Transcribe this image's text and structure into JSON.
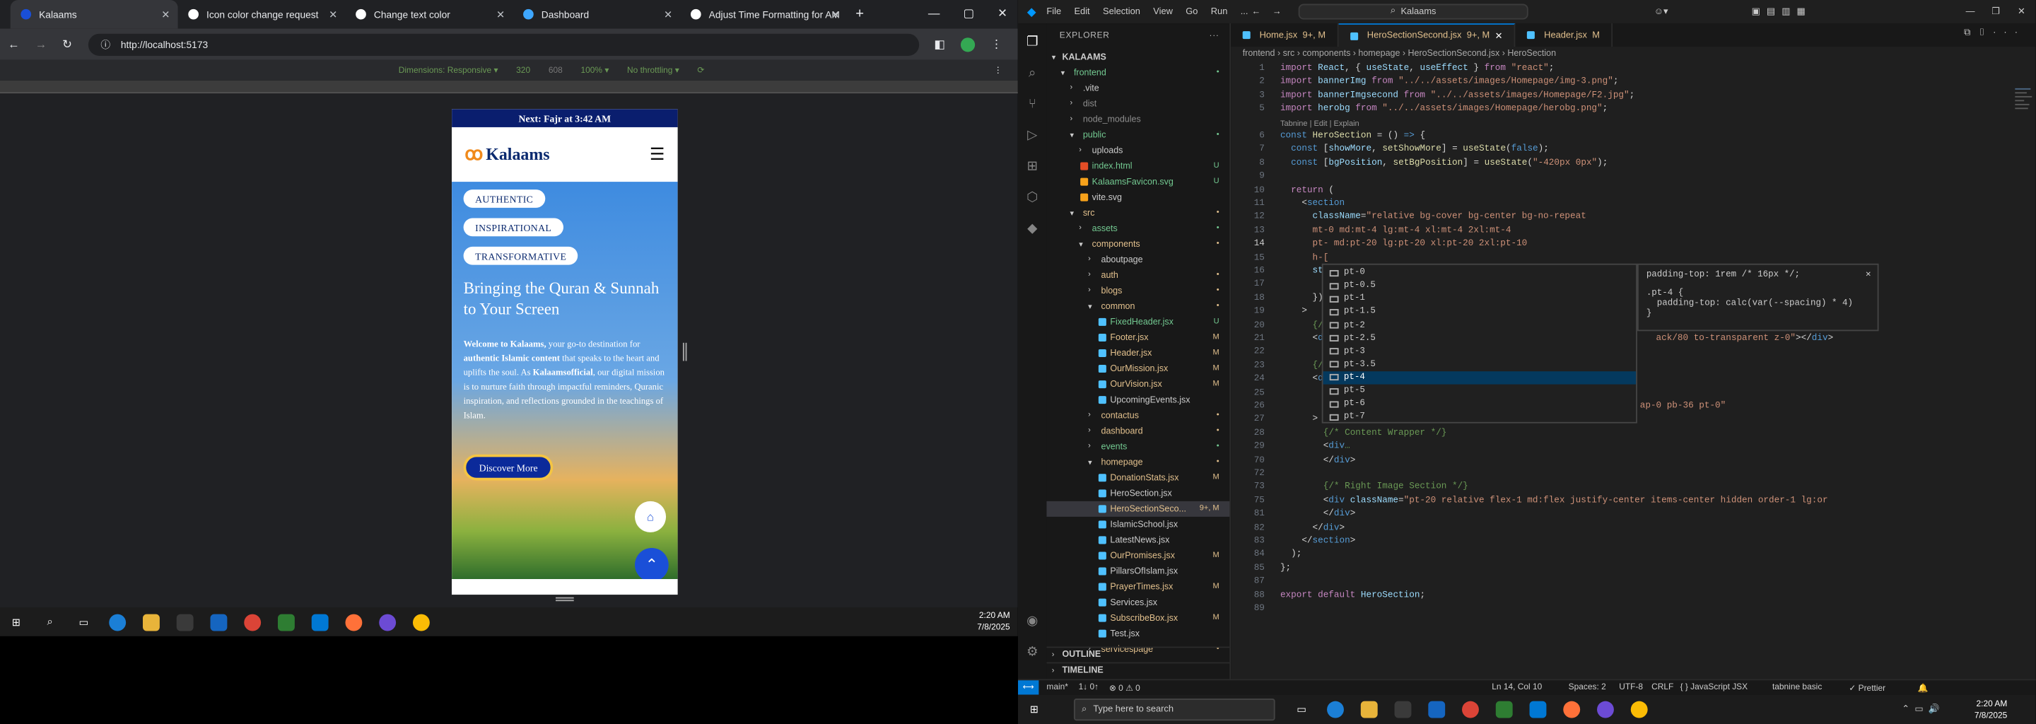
{
  "browser": {
    "tabs": [
      {
        "label": "Kalaams",
        "color": "#1a4fd8"
      },
      {
        "label": "Icon color change request",
        "color": "#ffffff"
      },
      {
        "label": "Change text color",
        "color": "#ffffff"
      },
      {
        "label": "Dashboard",
        "color": "#3ea7ff"
      },
      {
        "label": "Adjust Time Formatting for AM",
        "color": "#ffffff"
      }
    ],
    "url": "http://localhost:5173",
    "devtools": {
      "dimensions": "Dimensions: Responsive ▾",
      "width": "320",
      "height": "608",
      "zoom": "100% ▾",
      "throttle": "No throttling ▾"
    }
  },
  "site": {
    "prayer_banner": "Next: Fajr at 3:42 AM",
    "logo_text": "Kalaams",
    "pills": [
      "AUTHENTIC",
      "INSPIRATIONAL",
      "TRANSFORMATIVE"
    ],
    "hero_title": "Bringing the Quran & Sunnah to Your Screen",
    "hero_body_1": "Welcome to Kalaams,",
    "hero_body_2": " your go-to destination for ",
    "hero_body_3": "authentic Islamic content",
    "hero_body_4": " that speaks to the heart and uplifts the soul. As ",
    "hero_body_5": "Kalaamsofficial",
    "hero_body_6": ", our digital mission is to nurture faith through impactful reminders, Quranic inspiration, and reflections grounded in the teachings of Islam.",
    "cta": "Discover More"
  },
  "taskbar1": {
    "time": "2:20 AM",
    "date": "7/8/2025"
  },
  "vscode": {
    "menu": [
      "File",
      "Edit",
      "Selection",
      "View",
      "Go",
      "Run",
      "..."
    ],
    "search": "Kalaams",
    "explorer_title": "EXPLORER",
    "root": "KALAAMS",
    "tree": [
      {
        "name": "frontend",
        "depth": 1,
        "type": "folder-open",
        "badge": "•",
        "color": "#73c991"
      },
      {
        "name": ".vite",
        "depth": 2,
        "type": "folder",
        "badge": "",
        "color": "#cccccc"
      },
      {
        "name": "dist",
        "depth": 2,
        "type": "folder",
        "badge": "",
        "color": "#8c8c8c"
      },
      {
        "name": "node_modules",
        "depth": 2,
        "type": "folder",
        "badge": "",
        "color": "#8c8c8c"
      },
      {
        "name": "public",
        "depth": 2,
        "type": "folder-open",
        "badge": "•",
        "color": "#73c991"
      },
      {
        "name": "uploads",
        "depth": 3,
        "type": "folder",
        "badge": "",
        "color": "#cccccc"
      },
      {
        "name": "index.html",
        "depth": 3,
        "type": "html",
        "badge": "U",
        "color": "#73c991"
      },
      {
        "name": "KalaamsFavicon.svg",
        "depth": 3,
        "type": "svg",
        "badge": "U",
        "color": "#73c991"
      },
      {
        "name": "vite.svg",
        "depth": 3,
        "type": "svg",
        "badge": "",
        "color": "#cccccc"
      },
      {
        "name": "src",
        "depth": 2,
        "type": "folder-open",
        "badge": "•",
        "color": "#e2c08d"
      },
      {
        "name": "assets",
        "depth": 3,
        "type": "folder",
        "badge": "•",
        "color": "#73c991"
      },
      {
        "name": "components",
        "depth": 3,
        "type": "folder-open",
        "badge": "•",
        "color": "#e2c08d"
      },
      {
        "name": "aboutpage",
        "depth": 4,
        "type": "folder",
        "badge": "",
        "color": "#cccccc"
      },
      {
        "name": "auth",
        "depth": 4,
        "type": "folder",
        "badge": "•",
        "color": "#e2c08d"
      },
      {
        "name": "blogs",
        "depth": 4,
        "type": "folder",
        "badge": "•",
        "color": "#e2c08d"
      },
      {
        "name": "common",
        "depth": 4,
        "type": "folder-open",
        "badge": "•",
        "color": "#e2c08d"
      },
      {
        "name": "FixedHeader.jsx",
        "depth": 5,
        "type": "jsx",
        "badge": "U",
        "color": "#73c991"
      },
      {
        "name": "Footer.jsx",
        "depth": 5,
        "type": "jsx",
        "badge": "M",
        "color": "#e2c08d"
      },
      {
        "name": "Header.jsx",
        "depth": 5,
        "type": "jsx",
        "badge": "M",
        "color": "#e2c08d"
      },
      {
        "name": "OurMission.jsx",
        "depth": 5,
        "type": "jsx",
        "badge": "M",
        "color": "#e2c08d"
      },
      {
        "name": "OurVision.jsx",
        "depth": 5,
        "type": "jsx",
        "badge": "M",
        "color": "#e2c08d"
      },
      {
        "name": "UpcomingEvents.jsx",
        "depth": 5,
        "type": "jsx",
        "badge": "",
        "color": "#cccccc"
      },
      {
        "name": "contactus",
        "depth": 4,
        "type": "folder",
        "badge": "•",
        "color": "#e2c08d"
      },
      {
        "name": "dashboard",
        "depth": 4,
        "type": "folder",
        "badge": "•",
        "color": "#e2c08d"
      },
      {
        "name": "events",
        "depth": 4,
        "type": "folder",
        "badge": "•",
        "color": "#73c991"
      },
      {
        "name": "homepage",
        "depth": 4,
        "type": "folder-open",
        "badge": "•",
        "color": "#e2c08d"
      },
      {
        "name": "DonationStats.jsx",
        "depth": 5,
        "type": "jsx",
        "badge": "M",
        "color": "#e2c08d"
      },
      {
        "name": "HeroSection.jsx",
        "depth": 5,
        "type": "jsx",
        "badge": "",
        "color": "#cccccc"
      },
      {
        "name": "HeroSectionSeco...",
        "depth": 5,
        "type": "jsx",
        "badge": "9+, M",
        "color": "#e2c08d",
        "selected": true
      },
      {
        "name": "IslamicSchool.jsx",
        "depth": 5,
        "type": "jsx",
        "badge": "",
        "color": "#cccccc"
      },
      {
        "name": "LatestNews.jsx",
        "depth": 5,
        "type": "jsx",
        "badge": "",
        "color": "#cccccc"
      },
      {
        "name": "OurPromises.jsx",
        "depth": 5,
        "type": "jsx",
        "badge": "M",
        "color": "#e2c08d"
      },
      {
        "name": "PillarsOfIslam.jsx",
        "depth": 5,
        "type": "jsx",
        "badge": "",
        "color": "#cccccc"
      },
      {
        "name": "PrayerTimes.jsx",
        "depth": 5,
        "type": "jsx",
        "badge": "M",
        "color": "#e2c08d"
      },
      {
        "name": "Services.jsx",
        "depth": 5,
        "type": "jsx",
        "badge": "",
        "color": "#cccccc"
      },
      {
        "name": "SubscribeBox.jsx",
        "depth": 5,
        "type": "jsx",
        "badge": "M",
        "color": "#e2c08d"
      },
      {
        "name": "Test.jsx",
        "depth": 5,
        "type": "jsx",
        "badge": "",
        "color": "#cccccc"
      },
      {
        "name": "servicespage",
        "depth": 4,
        "type": "folder",
        "badge": "•",
        "color": "#e2c08d"
      }
    ],
    "outline": "OUTLINE",
    "timeline": "TIMELINE",
    "editor_tabs": [
      {
        "label": "Home.jsx",
        "badge": "9+, M",
        "active": false
      },
      {
        "label": "HeroSectionSecond.jsx",
        "badge": "9+, M",
        "active": true
      },
      {
        "label": "Header.jsx",
        "badge": "M",
        "active": false
      }
    ],
    "breadcrumb": "frontend › src › components › homepage › HeroSectionSecond.jsx › HeroSection",
    "codelens": "Tabnine | Edit | Explain",
    "code_lines": [
      {
        "n": "1",
        "html": "<span class='k'>import</span> <span class='v'>React</span>, { <span class='v'>useState</span>, <span class='v'>useEffect</span> } <span class='k'>from</span> <span class='str'>\"react\"</span>;"
      },
      {
        "n": "2",
        "html": "<span class='k'>import</span> <span class='v'>bannerImg</span> <span class='k'>from</span> <span class='str'>\"../../assets/images/Homepage/img-3.png\"</span>;"
      },
      {
        "n": "3",
        "html": "<span class='k'>import</span> <span class='v'>bannerImgsecond</span> <span class='k'>from</span> <span class='str'>\"../../assets/images/Homepage/F2.jpg\"</span>;"
      },
      {
        "n": "5",
        "html": "<span class='k'>import</span> <span class='v'>herobg</span> <span class='k'>from</span> <span class='str'>\"../../assets/images/Homepage/herobg.png\"</span>;"
      },
      {
        "n": "6",
        "html": "<span class='t'>const</span> <span class='f'>HeroSection</span> = () <span class='t'>=&gt;</span> {"
      },
      {
        "n": "7",
        "html": "  <span class='t'>const</span> [<span class='v'>showMore</span>, <span class='f'>setShowMore</span>] = <span class='f'>useState</span>(<span class='t'>false</span>);"
      },
      {
        "n": "8",
        "html": "  <span class='t'>const</span> [<span class='v'>bgPosition</span>, <span class='f'>setBgPosition</span>] = <span class='f'>useState</span>(<span class='str'>\"-420px 0px\"</span>);"
      },
      {
        "n": "9",
        "html": ""
      },
      {
        "n": "10",
        "html": "  <span class='k'>return</span> ("
      },
      {
        "n": "11",
        "html": "    &lt;<span class='t'>section</span>"
      },
      {
        "n": "12",
        "html": "      <span class='v'>className</span>=<span class='str'>\"relative bg-cover bg-center bg-no-repeat</span>"
      },
      {
        "n": "13",
        "html": "<span class='str'>      mt-0 md:mt-4 lg:mt-4 xl:mt-4 2xl:mt-4</span>"
      },
      {
        "n": "14",
        "html": "<span class='str'>      pt- md:pt-20 lg:pt-20 xl:pt-20 2xl:pt-10</span>"
      },
      {
        "n": "15",
        "html": "      <span class='str'>h-[</span>"
      },
      {
        "n": "16",
        "html": "      <span class='v'>sty</span>"
      },
      {
        "n": "17",
        "html": "        <span class='v'>b</span>"
      },
      {
        "n": "18",
        "html": "      })"
      },
      {
        "n": "19",
        "html": "    &gt;"
      },
      {
        "n": "20",
        "html": "      <span class='c'>{/*</span>"
      },
      {
        "n": "21",
        "html": "      &lt;<span class='t'>di</span>                                                             <span class='str'>ack/80 to-transparent z-0\"</span>&gt;&lt;/<span class='t'>div</span>&gt;"
      },
      {
        "n": "22",
        "html": ""
      },
      {
        "n": "23",
        "html": "      <span class='c'>{/*</span>"
      },
      {
        "n": "24",
        "html": "      &lt;<span class='t'>di</span>"
      },
      {
        "n": "25",
        "html": "        <span class='v'>c</span>"
      },
      {
        "n": "26",
        "html": "                                                                   <span class='str'>ap-0 pb-36 pt-0\"</span>"
      },
      {
        "n": "27",
        "html": "      &gt;"
      },
      {
        "n": "28",
        "html": "        <span class='c'>{/* Content Wrapper */}</span>"
      },
      {
        "n": "29",
        "html": "        &lt;<span class='t'>div</span><span class='c'>…</span>"
      },
      {
        "n": "70",
        "html": "        &lt;/<span class='t'>div</span>&gt;"
      },
      {
        "n": "72",
        "html": ""
      },
      {
        "n": "73",
        "html": "        <span class='c'>{/* Right Image Section */}</span>"
      },
      {
        "n": "75",
        "html": "        &lt;<span class='t'>div</span> <span class='v'>className</span>=<span class='str'>\"pt-20 relative flex-1 md:flex justify-center items-center hidden order-1 lg:or</span>"
      },
      {
        "n": "81",
        "html": "        &lt;/<span class='t'>div</span>&gt;"
      },
      {
        "n": "82",
        "html": "      &lt;/<span class='t'>div</span>&gt;"
      },
      {
        "n": "83",
        "html": "    &lt;/<span class='t'>section</span>&gt;"
      },
      {
        "n": "84",
        "html": "  );"
      },
      {
        "n": "85",
        "html": "};"
      },
      {
        "n": "87",
        "html": ""
      },
      {
        "n": "88",
        "html": "<span class='k'>export</span> <span class='k'>default</span> <span class='v'>HeroSection</span>;"
      },
      {
        "n": "89",
        "html": ""
      }
    ],
    "suggestions": [
      "pt-0",
      "pt-0.5",
      "pt-1",
      "pt-1.5",
      "pt-2",
      "pt-2.5",
      "pt-3",
      "pt-3.5",
      "pt-4",
      "pt-5",
      "pt-6",
      "pt-7"
    ],
    "suggestion_doc": {
      "line1": "padding-top: 1rem /* 16px */;",
      "line2": ".pt-4 {",
      "line3": "  padding-top: calc(var(--spacing) * 4)",
      "line4": "}"
    },
    "status": {
      "branch": "main*",
      "sync": "1↓ 0↑",
      "problems": "⊗ 0 ⚠ 0",
      "position": "Ln 14, Col 10",
      "spaces": "Spaces: 2",
      "encoding": "UTF-8",
      "eol": "CRLF",
      "language": "{ } JavaScript JSX",
      "tabnine": "tabnine basic",
      "prettier": "✓ Prettier"
    }
  },
  "taskbar2": {
    "search_placeholder": "Type here to search",
    "time": "2:20 AM",
    "date": "7/8/2025"
  }
}
